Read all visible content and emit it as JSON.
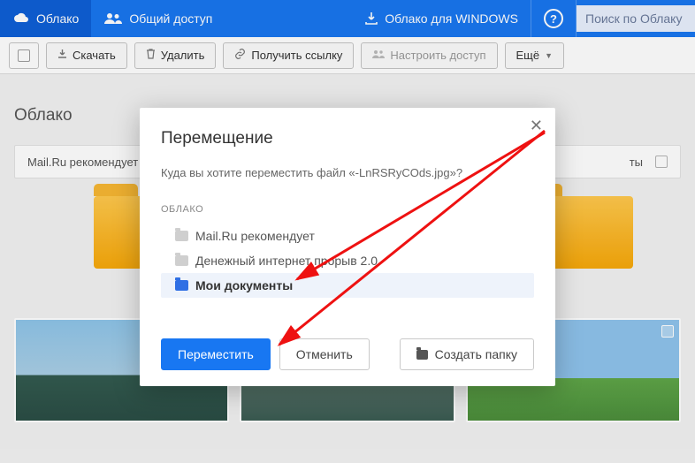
{
  "header": {
    "cloud": "Облако",
    "shared": "Общий доступ",
    "windows": "Облако для WINDOWS",
    "help": "?",
    "search_placeholder": "Поиск по Облаку"
  },
  "toolbar": {
    "download": "Скачать",
    "delete": "Удалить",
    "getlink": "Получить ссылку",
    "configure": "Настроить доступ",
    "more": "Ещё"
  },
  "page": {
    "title": "Облако",
    "recommend_label": "Mail.Ru рекомендует",
    "recommend_right": "ты"
  },
  "modal": {
    "title": "Перемещение",
    "prompt": "Куда вы хотите переместить файл «-LnRSRyCOds.jpg»?",
    "tree_root": "ОБЛАКО",
    "items": [
      "Mail.Ru рекомендует",
      "Денежный интернет прорыв 2.0",
      "Мои документы"
    ],
    "move": "Переместить",
    "cancel": "Отменить",
    "newfolder": "Создать папку"
  }
}
